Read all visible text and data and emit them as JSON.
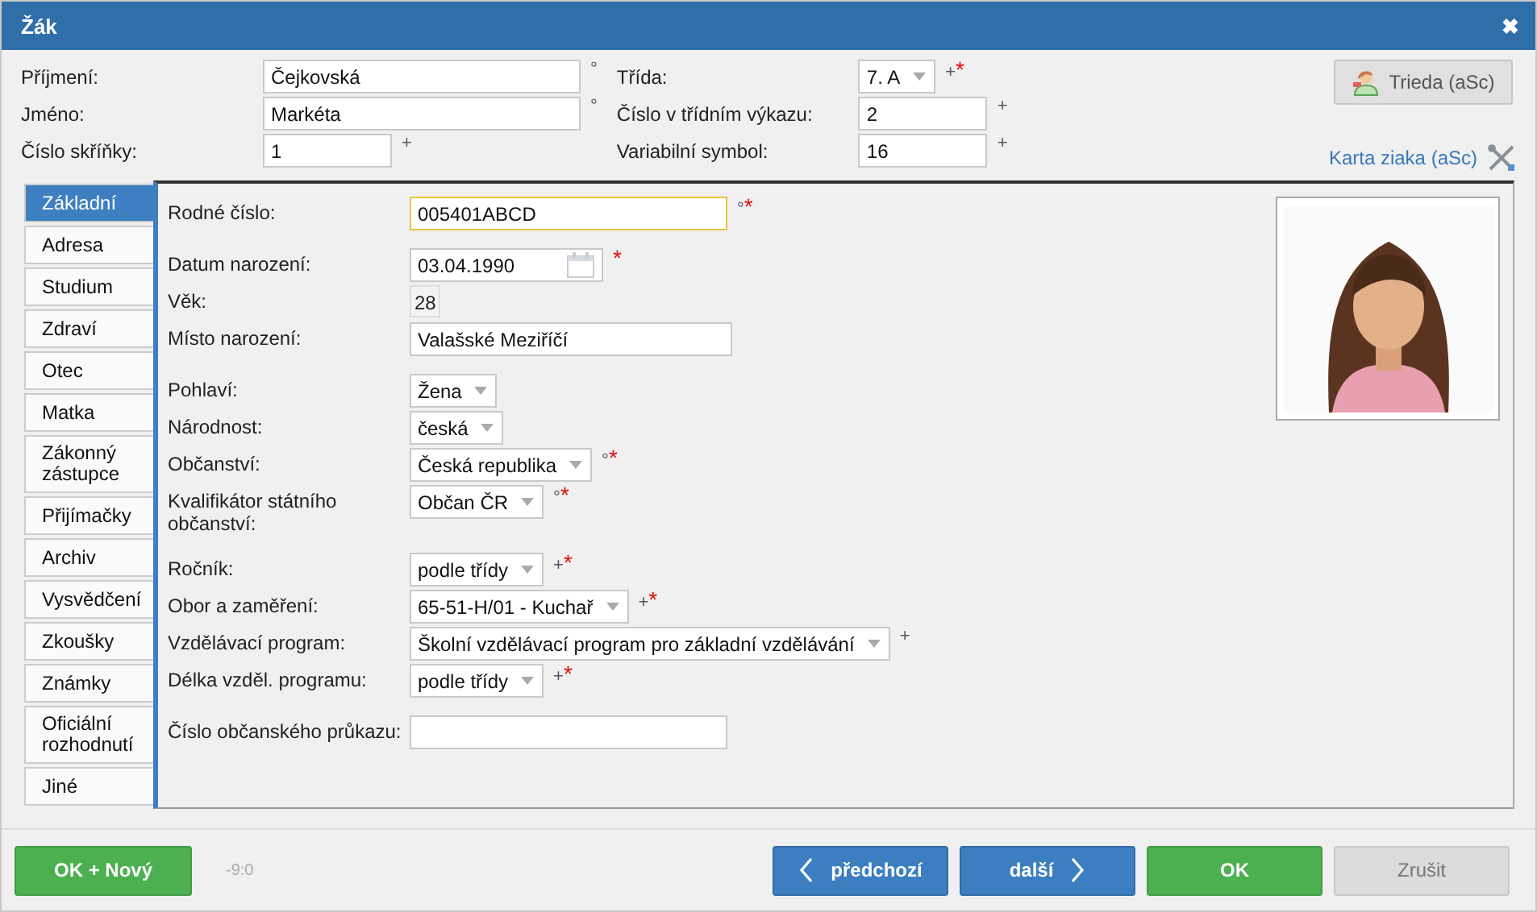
{
  "window": {
    "title": "Žák",
    "close": "✖"
  },
  "header": {
    "left": [
      {
        "label": "Příjmení:",
        "kind": "text",
        "value": "Čejkovská",
        "marker": "°"
      },
      {
        "label": "Jméno:",
        "kind": "text",
        "value": "Markéta",
        "marker": "°"
      },
      {
        "label": "Číslo skříňky:",
        "kind": "short",
        "value": "1",
        "marker": "+"
      }
    ],
    "middle": [
      {
        "label": "Třída:",
        "kind": "select",
        "value": "7. A",
        "marker": "+",
        "asterisk": "*"
      },
      {
        "label": "Číslo v třídním výkazu:",
        "kind": "short",
        "value": "2",
        "marker": "+"
      },
      {
        "label": "Variabilní symbol:",
        "kind": "medium",
        "value": "16",
        "marker": "+"
      }
    ],
    "class_button": "Trieda (aSc)",
    "card_link": "Karta ziaka (aSc)"
  },
  "tabs": [
    {
      "label": "Základní",
      "selected": true
    },
    {
      "label": "Adresa",
      "selected": false
    },
    {
      "label": "Studium",
      "selected": false
    },
    {
      "label": "Zdraví",
      "selected": false
    },
    {
      "label": "Otec",
      "selected": false
    },
    {
      "label": "Matka",
      "selected": false
    },
    {
      "label": "Zákonný zástupce",
      "selected": false
    },
    {
      "label": "Přijímačky",
      "selected": false
    },
    {
      "label": "Archiv",
      "selected": false
    },
    {
      "label": "Vysvědčení",
      "selected": false
    },
    {
      "label": "Zkoušky",
      "selected": false
    },
    {
      "label": "Známky",
      "selected": false
    },
    {
      "label": "Oficiální rozhodnutí",
      "selected": false
    },
    {
      "label": "Jiné",
      "selected": false
    }
  ],
  "sections": [
    [
      {
        "label": "Rodné číslo:",
        "kind": "text",
        "value": "005401ABCD",
        "marker": "°",
        "asterisk": "*",
        "focused": true
      }
    ],
    [
      {
        "label": "Datum narození:",
        "kind": "date",
        "value": "03.04.1990",
        "asterisk": "*"
      },
      {
        "label": "Věk:",
        "kind": "static",
        "value": "28"
      },
      {
        "label": "Místo narození:",
        "kind": "wide",
        "value": "Valašské Meziříčí"
      }
    ],
    [
      {
        "label": "Pohlaví:",
        "kind": "select",
        "value": "Žena"
      },
      {
        "label": "Národnost:",
        "kind": "select",
        "value": "česká"
      },
      {
        "label": "Občanství:",
        "kind": "select",
        "value": "Česká republika",
        "marker": "°",
        "asterisk": "*"
      },
      {
        "label": "Kvalifikátor státního občanství:",
        "kind": "select",
        "value": "Občan ČR",
        "marker": "°",
        "asterisk": "*"
      }
    ],
    [
      {
        "label": "Ročník:",
        "kind": "select",
        "value": "podle třídy",
        "marker": "+",
        "asterisk": "*"
      },
      {
        "label": "Obor a zaměření:",
        "kind": "select",
        "value": "65-51-H/01 - Kuchař",
        "marker": "+",
        "asterisk": "*"
      },
      {
        "label": "Vzdělávací program:",
        "kind": "select",
        "value": "Školní vzdělávací program pro základní vzdělávání",
        "marker": "+"
      },
      {
        "label": "Délka vzděl. programu:",
        "kind": "select",
        "value": "podle třídy",
        "marker": "+",
        "asterisk": "*"
      }
    ],
    [
      {
        "label": "Číslo občanského průkazu:",
        "kind": "text"
      }
    ]
  ],
  "photo": {
    "kind": "picture"
  },
  "footer": {
    "ok_new": "OK + Nový",
    "version": "-9:0",
    "previous": "předchozí",
    "next": "další",
    "ok": "OK",
    "cancel": "Zrušit",
    "cancel_disabled": true
  }
}
